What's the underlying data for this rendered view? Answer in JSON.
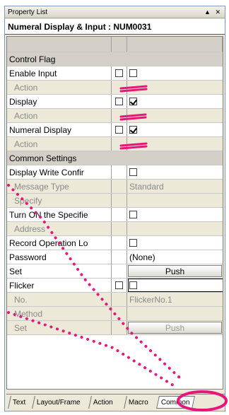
{
  "window": {
    "title": "Property List",
    "controls": "▲ ✕"
  },
  "header": {
    "title": "Numeral Display & Input : NUM0031"
  },
  "rows": [
    {
      "kind": "headrow"
    },
    {
      "kind": "section",
      "label": "Control Flag"
    },
    {
      "kind": "prop",
      "label": "Enable Input",
      "chk": false,
      "valchk": false
    },
    {
      "kind": "sub",
      "label": "Action"
    },
    {
      "kind": "prop",
      "label": "Display",
      "chk": false,
      "valchk": true
    },
    {
      "kind": "sub",
      "label": "Action"
    },
    {
      "kind": "prop",
      "label": "Numeral Display",
      "chk": false,
      "valchk": true
    },
    {
      "kind": "sub",
      "label": "Action"
    },
    {
      "kind": "section",
      "label": "Common Settings"
    },
    {
      "kind": "prop",
      "label": "Display Write Confir",
      "valchk": false
    },
    {
      "kind": "sub",
      "label": "Message Type",
      "value": "Standard"
    },
    {
      "kind": "sub",
      "label": "Specify"
    },
    {
      "kind": "prop",
      "label": "Turn ON the Specifie",
      "valchk": false
    },
    {
      "kind": "sub",
      "label": "Address"
    },
    {
      "kind": "prop",
      "label": "Record Operation Lo",
      "valchk": false
    },
    {
      "kind": "prop",
      "label": "Password",
      "value": "(None)"
    },
    {
      "kind": "propbtn",
      "label": "Set",
      "button": "Push"
    },
    {
      "kind": "prop",
      "label": "Flicker",
      "chk": false,
      "valchk": false,
      "active": true
    },
    {
      "kind": "sub",
      "label": "No.",
      "value": "FlickerNo.1"
    },
    {
      "kind": "sub",
      "label": "Method"
    },
    {
      "kind": "subbtn",
      "label": "Set",
      "button": "Push"
    }
  ],
  "tabs": [
    {
      "label": "Text",
      "active": false
    },
    {
      "label": "Layout/Frame",
      "active": false
    },
    {
      "label": "Action",
      "active": false
    },
    {
      "label": "Macro",
      "active": false
    },
    {
      "label": "Common",
      "active": true
    }
  ],
  "colors": {
    "annotation": "#e8157a"
  }
}
